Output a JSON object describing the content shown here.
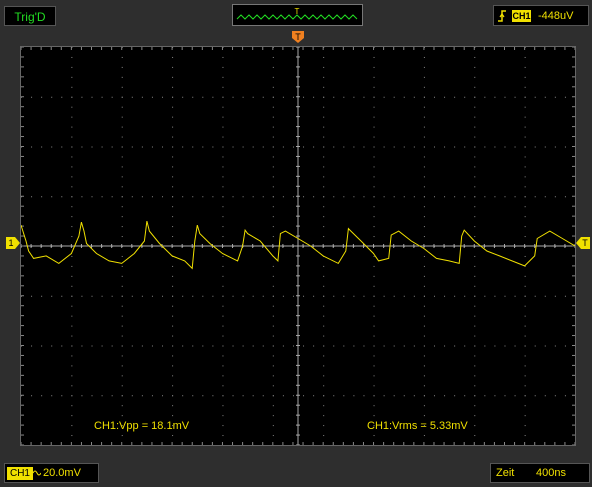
{
  "status": {
    "trigger_state": "Trig'D"
  },
  "trigger": {
    "source": "CH1",
    "level": "-448uV",
    "edge": "rising-edge-icon",
    "marker_label": "T"
  },
  "channel": {
    "label": "1",
    "name": "CH1",
    "coupling_icon": "ac-coupling-icon",
    "scale": "20.0mV",
    "color": "#f0e000"
  },
  "timebase": {
    "label": "Zeit",
    "value": "400ns"
  },
  "measurements": {
    "vpp": "CH1:Vpp = 18.1mV",
    "vrms": "CH1:Vrms = 5.33mV"
  },
  "chart_data": {
    "type": "line",
    "title": "",
    "xlabel": "",
    "ylabel": "",
    "grid": true,
    "x_divisions": 11,
    "y_divisions": 8,
    "series": [
      {
        "name": "CH1",
        "x_div": [
          0,
          0.1,
          0.15,
          0.25,
          0.5,
          0.75,
          1.0,
          1.15,
          1.2,
          1.25,
          1.3,
          1.5,
          1.75,
          2.0,
          2.25,
          2.45,
          2.5,
          2.55,
          2.75,
          3.0,
          3.25,
          3.4,
          3.45,
          3.5,
          3.55,
          3.75,
          4.0,
          4.3,
          4.4,
          4.45,
          4.5,
          4.75,
          5.0,
          5.1,
          5.15,
          5.25,
          5.5,
          5.75,
          6.0,
          6.3,
          6.45,
          6.5,
          6.55,
          6.75,
          7.0,
          7.1,
          7.3,
          7.35,
          7.5,
          7.75,
          8.0,
          8.25,
          8.5,
          8.7,
          8.75,
          8.8,
          9.0,
          9.25,
          9.5,
          9.75,
          10.0,
          10.2,
          10.25,
          10.5,
          10.75,
          11.0
        ],
        "y_div": [
          0.42,
          0.1,
          -0.1,
          -0.25,
          -0.2,
          -0.35,
          -0.15,
          0.2,
          0.48,
          0.3,
          0.05,
          -0.15,
          -0.3,
          -0.35,
          -0.15,
          0.1,
          0.5,
          0.3,
          0.05,
          -0.2,
          -0.3,
          -0.45,
          0.1,
          0.42,
          0.25,
          0.05,
          -0.15,
          -0.3,
          0.0,
          0.32,
          0.25,
          0.1,
          -0.2,
          -0.3,
          0.25,
          0.3,
          0.15,
          0.0,
          -0.2,
          -0.35,
          -0.1,
          0.35,
          0.3,
          0.1,
          -0.15,
          -0.3,
          -0.25,
          0.22,
          0.3,
          0.1,
          -0.05,
          -0.25,
          -0.3,
          -0.35,
          0.2,
          0.32,
          0.1,
          -0.1,
          -0.2,
          -0.3,
          -0.4,
          -0.2,
          0.15,
          0.3,
          0.15,
          0.0
        ],
        "offset_div": 0
      }
    ]
  }
}
